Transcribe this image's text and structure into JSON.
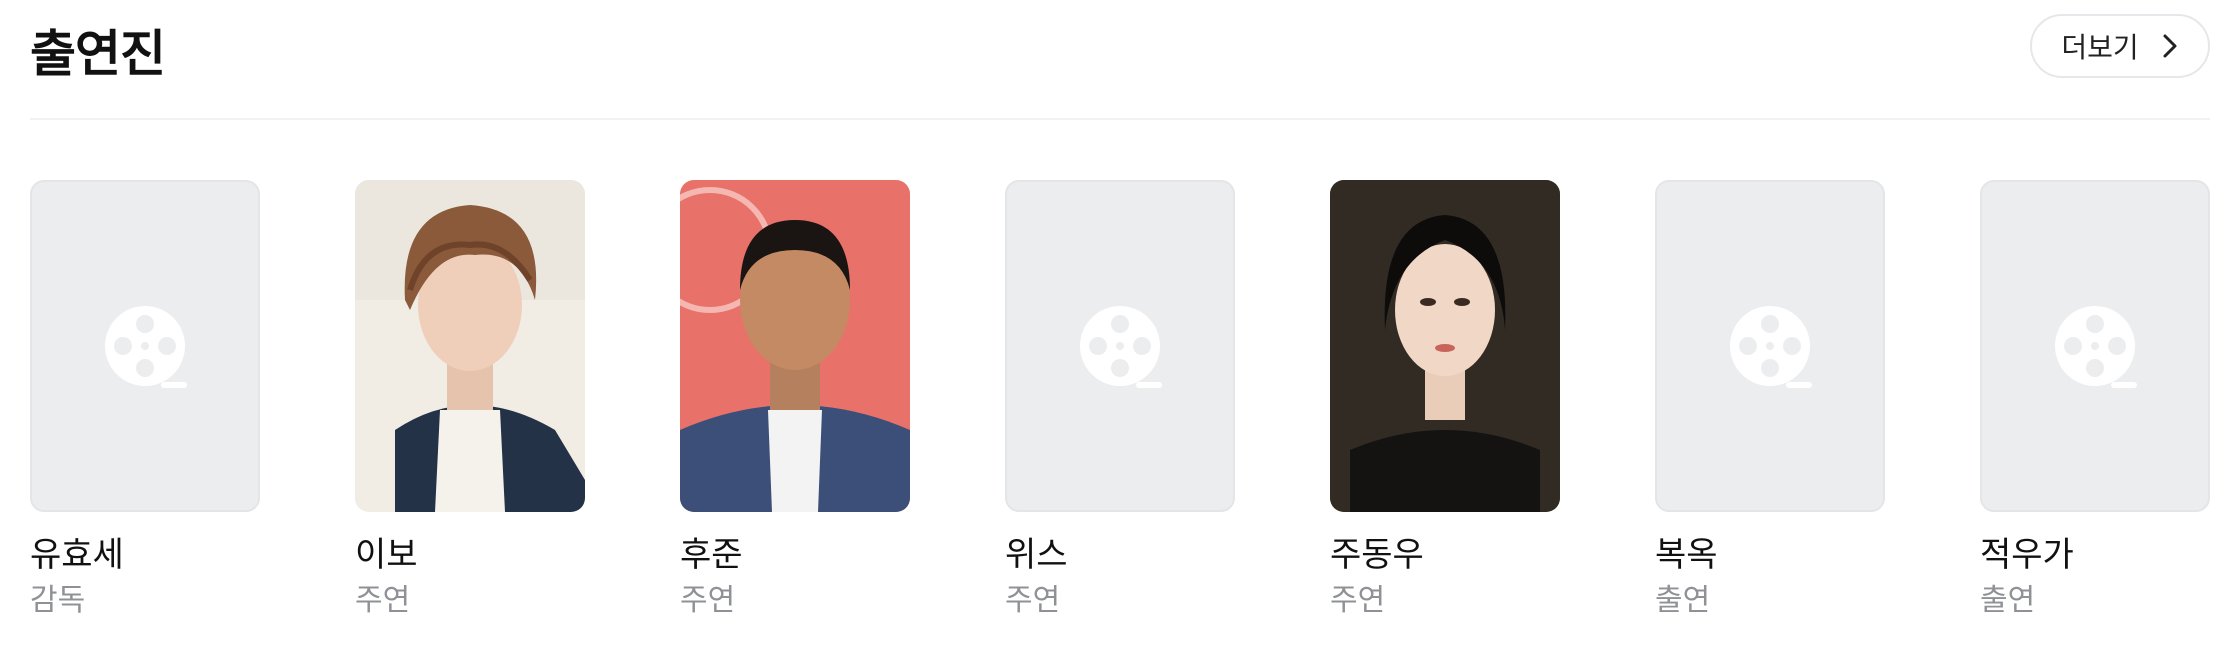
{
  "section": {
    "title": "출연진",
    "more_button_label": "더보기",
    "more_icon": "chevron-right-icon"
  },
  "cast": [
    {
      "name": "유효세",
      "role": "감독",
      "photo": "film-reel-placeholder-icon"
    },
    {
      "name": "이보",
      "role": "주연",
      "photo": "portrait-photo"
    },
    {
      "name": "후준",
      "role": "주연",
      "photo": "portrait-photo"
    },
    {
      "name": "위스",
      "role": "주연",
      "photo": "film-reel-placeholder-icon"
    },
    {
      "name": "주동우",
      "role": "주연",
      "photo": "portrait-photo"
    },
    {
      "name": "복옥",
      "role": "출연",
      "photo": "film-reel-placeholder-icon"
    },
    {
      "name": "적우가",
      "role": "출연",
      "photo": "film-reel-placeholder-icon"
    }
  ],
  "colors": {
    "placeholder_bg": "#ecedef",
    "role_text": "#8f9196",
    "divider": "#f0f1f3"
  }
}
